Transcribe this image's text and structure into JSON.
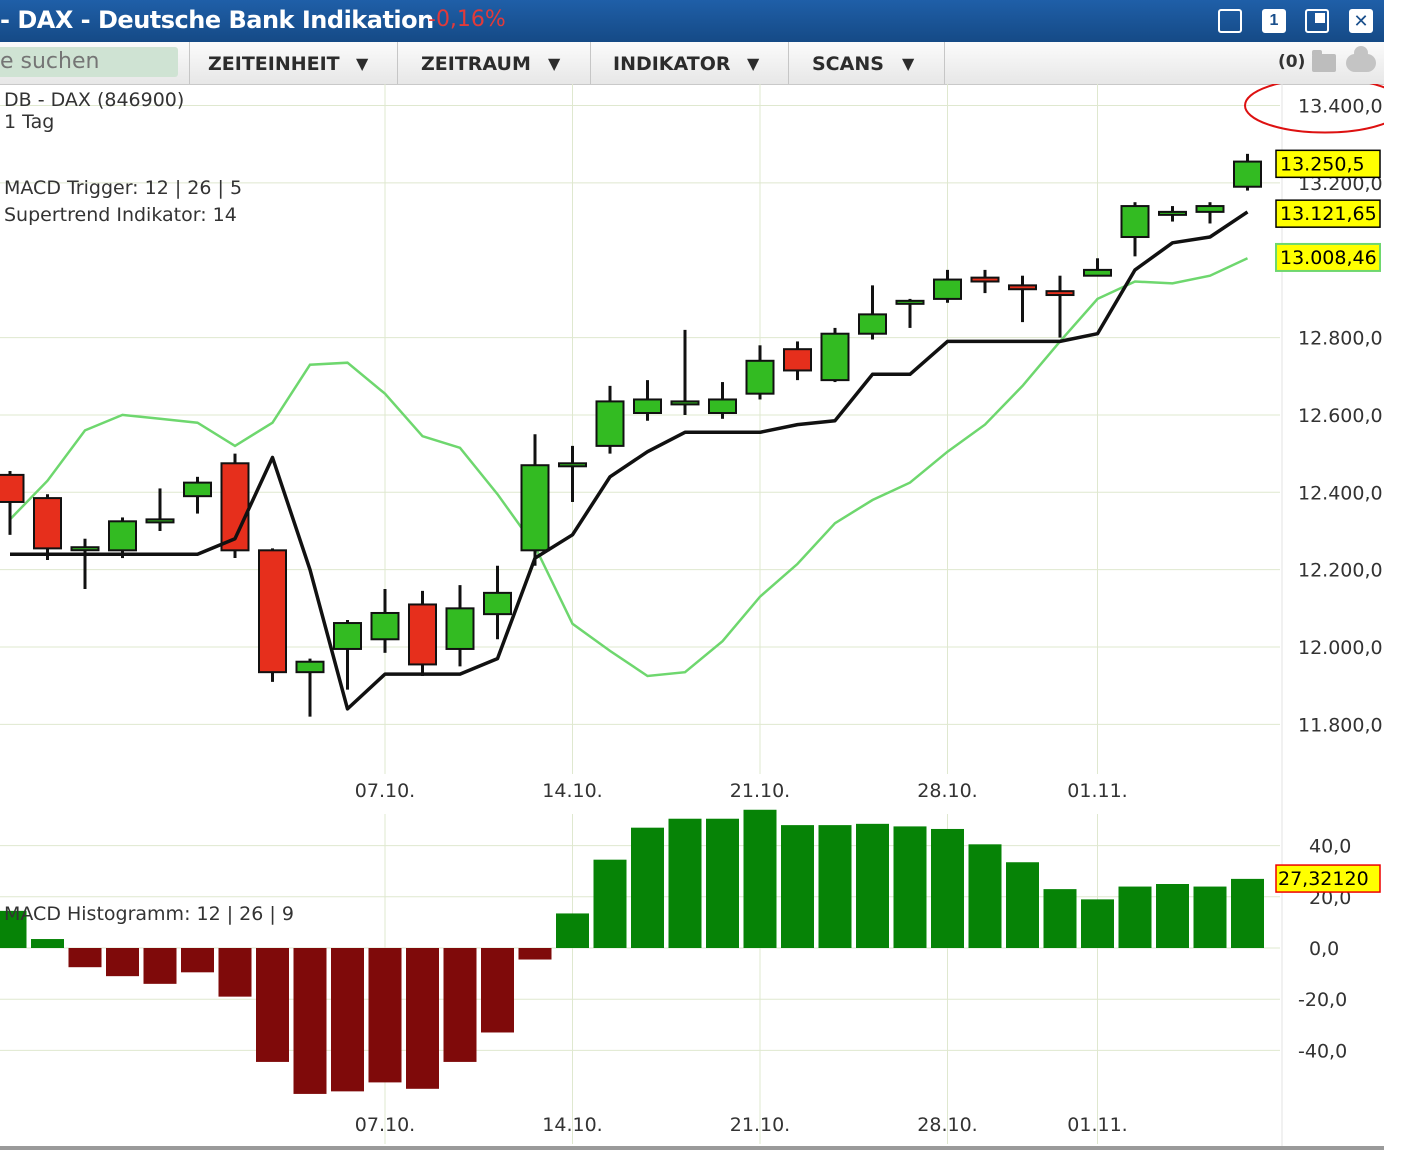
{
  "window": {
    "title": "- DAX - Deutsche Bank Indikation",
    "change": "-0,16%",
    "buttons": {
      "one": "1",
      "close": "✕"
    }
  },
  "toolbar": {
    "search_placeholder": "e suchen",
    "menus": [
      {
        "label": "ZEITEINHEIT",
        "arrow": "▼"
      },
      {
        "label": "ZEITRAUM",
        "arrow": "▼"
      },
      {
        "label": "INDIKATOR",
        "arrow": "▼"
      },
      {
        "label": "SCANS",
        "arrow": "▼"
      }
    ],
    "counter": "(0)",
    "icons": [
      "folder-icon",
      "cloud-icon"
    ]
  },
  "chart_data": [
    {
      "type": "candlestick",
      "legend": [
        "DB - DAX (846900)",
        "1 Tag",
        "MACD Trigger: 12 | 26 | 5",
        "Supertrend Indikator: 14"
      ],
      "ylim": [
        11700,
        13480
      ],
      "yticks": [
        {
          "value": 13400,
          "label": "13.400,0"
        },
        {
          "value": 13200,
          "label": "13.200,0"
        },
        {
          "value": 12800,
          "label": "12.800,0"
        },
        {
          "value": 12600,
          "label": "12.600,0"
        },
        {
          "value": 12400,
          "label": "12.400,0"
        },
        {
          "value": 12200,
          "label": "12.200,0"
        },
        {
          "value": 12000,
          "label": "12.000,0"
        },
        {
          "value": 11800,
          "label": "11.800,0"
        }
      ],
      "xticks": [
        {
          "index": 10,
          "label": "07.10."
        },
        {
          "index": 15,
          "label": "14.10."
        },
        {
          "index": 20,
          "label": "21.10."
        },
        {
          "index": 25,
          "label": "28.10."
        },
        {
          "index": 29,
          "label": "01.11."
        }
      ],
      "candles": [
        {
          "o": 12445,
          "h": 12455,
          "l": 12290,
          "c": 12375
        },
        {
          "o": 12385,
          "h": 12395,
          "l": 12225,
          "c": 12255
        },
        {
          "o": 12255,
          "h": 12280,
          "l": 12150,
          "c": 12258
        },
        {
          "o": 12250,
          "h": 12335,
          "l": 12230,
          "c": 12325
        },
        {
          "o": 12325,
          "h": 12410,
          "l": 12300,
          "c": 12330
        },
        {
          "o": 12390,
          "h": 12440,
          "l": 12345,
          "c": 12425
        },
        {
          "o": 12475,
          "h": 12500,
          "l": 12230,
          "c": 12250
        },
        {
          "o": 12250,
          "h": 12255,
          "l": 11910,
          "c": 11935
        },
        {
          "o": 11935,
          "h": 11970,
          "l": 11820,
          "c": 11962
        },
        {
          "o": 11995,
          "h": 12070,
          "l": 11890,
          "c": 12062
        },
        {
          "o": 12020,
          "h": 12150,
          "l": 11985,
          "c": 12088
        },
        {
          "o": 12110,
          "h": 12145,
          "l": 11925,
          "c": 11955
        },
        {
          "o": 11995,
          "h": 12160,
          "l": 11950,
          "c": 12100
        },
        {
          "o": 12085,
          "h": 12210,
          "l": 12020,
          "c": 12140
        },
        {
          "o": 12250,
          "h": 12550,
          "l": 12210,
          "c": 12470
        },
        {
          "o": 12470,
          "h": 12520,
          "l": 12375,
          "c": 12475
        },
        {
          "o": 12520,
          "h": 12675,
          "l": 12500,
          "c": 12635
        },
        {
          "o": 12605,
          "h": 12690,
          "l": 12585,
          "c": 12640
        },
        {
          "o": 12630,
          "h": 12820,
          "l": 12600,
          "c": 12635
        },
        {
          "o": 12605,
          "h": 12685,
          "l": 12590,
          "c": 12640
        },
        {
          "o": 12655,
          "h": 12780,
          "l": 12640,
          "c": 12740
        },
        {
          "o": 12770,
          "h": 12790,
          "l": 12690,
          "c": 12715
        },
        {
          "o": 12690,
          "h": 12825,
          "l": 12685,
          "c": 12810
        },
        {
          "o": 12810,
          "h": 12935,
          "l": 12795,
          "c": 12860
        },
        {
          "o": 12890,
          "h": 12900,
          "l": 12825,
          "c": 12895
        },
        {
          "o": 12900,
          "h": 12975,
          "l": 12890,
          "c": 12950
        },
        {
          "o": 12955,
          "h": 12975,
          "l": 12915,
          "c": 12945
        },
        {
          "o": 12935,
          "h": 12960,
          "l": 12840,
          "c": 12925
        },
        {
          "o": 12920,
          "h": 12960,
          "l": 12800,
          "c": 12910
        },
        {
          "o": 12960,
          "h": 13005,
          "l": 12960,
          "c": 12975
        },
        {
          "o": 13060,
          "h": 13150,
          "l": 13010,
          "c": 13140
        },
        {
          "o": 13120,
          "h": 13140,
          "l": 13100,
          "c": 13125
        },
        {
          "o": 13125,
          "h": 13150,
          "l": 13095,
          "c": 13140
        },
        {
          "o": 13190,
          "h": 13275,
          "l": 13180,
          "c": 13255
        }
      ],
      "supertrend": [
        12240,
        12240,
        12240,
        12240,
        12240,
        12240,
        12280,
        12490,
        12200,
        11840,
        11930,
        11930,
        11930,
        11970,
        12230,
        12290,
        12440,
        12505,
        12555,
        12555,
        12555,
        12575,
        12585,
        12705,
        12705,
        12790,
        12790,
        12790,
        12790,
        12810,
        12975,
        13045,
        13060,
        13125
      ],
      "macd_trigger": [
        12330,
        12430,
        12560,
        12600,
        12590,
        12580,
        12520,
        12580,
        12730,
        12735,
        12655,
        12545,
        12515,
        12395,
        12260,
        12060,
        11990,
        11925,
        11935,
        12015,
        12130,
        12215,
        12320,
        12380,
        12425,
        12505,
        12575,
        12675,
        12790,
        12900,
        12945,
        12940,
        12960,
        13005
      ],
      "price_labels": [
        {
          "value": 13250.5,
          "label": "13.250,5"
        },
        {
          "value": 13121.65,
          "label": "13.121,65"
        },
        {
          "value": 13008.46,
          "label": "13.008,46"
        }
      ],
      "annotation": "red circle around 13.400,0"
    },
    {
      "type": "bar",
      "legend": "MACD Histogramm: 12 | 26 | 9",
      "ylim": [
        -55,
        65
      ],
      "yticks": [
        {
          "value": 40,
          "label": "40,0"
        },
        {
          "value": 20,
          "label": "20,0"
        },
        {
          "value": 0,
          "label": "0,0"
        },
        {
          "value": -20,
          "label": "-20,0"
        },
        {
          "value": -40,
          "label": "-40,0"
        }
      ],
      "xticks": [
        {
          "index": 10,
          "label": "07.10."
        },
        {
          "index": 15,
          "label": "14.10."
        },
        {
          "index": 20,
          "label": "21.10."
        },
        {
          "index": 25,
          "label": "28.10."
        },
        {
          "index": 29,
          "label": "01.11."
        }
      ],
      "values": [
        14.5,
        3.5,
        -7.5,
        -11,
        -14,
        -9.5,
        -19,
        -44.5,
        -57,
        -56,
        -52.5,
        -55,
        -44.5,
        -33,
        -4.5,
        13.5,
        34.5,
        47,
        50.5,
        50.5,
        54,
        48,
        48,
        48.5,
        47.5,
        46.5,
        40.5,
        33.5,
        23,
        19,
        24,
        25,
        24,
        27
      ],
      "current": {
        "value": 27.3212,
        "label": "27,32120"
      }
    }
  ],
  "colors": {
    "up": "#33bb22",
    "down": "#e62f1c",
    "hist_pos": "#068306",
    "hist_neg": "#7f0a0a",
    "supertrend": "#111111",
    "macd_trigger": "#6ed76e",
    "grid": "#dfe8cf",
    "highlight": "#ffff00"
  }
}
